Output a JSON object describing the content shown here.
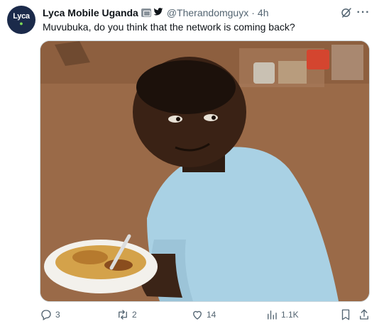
{
  "tweet": {
    "author": {
      "display_name": "Lyca Mobile Uganda",
      "handle": "@Therandomguyx",
      "avatar_text": "Lyca",
      "avatar_icon": "avatar-logo",
      "affiliate_badge_icon": "affiliate-badge-icon",
      "bird_badge_icon": "bird-icon"
    },
    "separator": "·",
    "time": "4h",
    "text": "Muvubuka, do you think that the network is coming back?",
    "media": {
      "description_icon": "meme-photo"
    },
    "actions": {
      "reply_count": "3",
      "retweet_count": "2",
      "like_count": "14",
      "views_count": "1.1K"
    }
  },
  "colors": {
    "text": "#0f1419",
    "secondary": "#536471",
    "avatar_bg": "#1b2a4a",
    "avatar_accent": "#7ed957"
  }
}
